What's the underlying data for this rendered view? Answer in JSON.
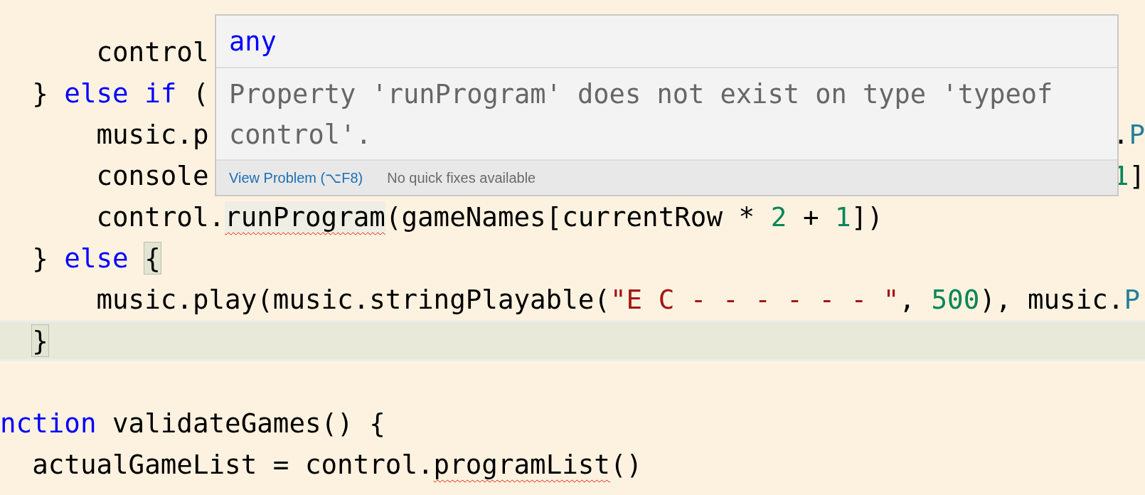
{
  "editor": {
    "lines": [
      {
        "current": false,
        "tokens": [
          {
            "kind": "plain",
            "text": "      control"
          }
        ]
      },
      {
        "current": false,
        "tokens": [
          {
            "kind": "plain",
            "text": "  } "
          },
          {
            "kind": "keyword",
            "text": "else if"
          },
          {
            "kind": "plain",
            "text": " ("
          }
        ]
      },
      {
        "current": false,
        "tokens": [
          {
            "kind": "plain",
            "text": "      music.p"
          }
        ],
        "right": [
          {
            "kind": "plain",
            "text": "."
          },
          {
            "kind": "type",
            "text": "P"
          }
        ]
      },
      {
        "current": false,
        "tokens": [
          {
            "kind": "plain",
            "text": "      console"
          }
        ],
        "right": [
          {
            "kind": "number",
            "text": "1"
          },
          {
            "kind": "plain",
            "text": "]"
          }
        ]
      },
      {
        "current": false,
        "tokens": [
          {
            "kind": "plain",
            "text": "      control."
          },
          {
            "kind": "hovered_error",
            "text": "runProgram"
          },
          {
            "kind": "plain",
            "text": "(gameNames[currentRow * "
          },
          {
            "kind": "number",
            "text": "2"
          },
          {
            "kind": "plain",
            "text": " + "
          },
          {
            "kind": "number",
            "text": "1"
          },
          {
            "kind": "plain",
            "text": "])"
          }
        ]
      },
      {
        "current": false,
        "tokens": [
          {
            "kind": "plain",
            "text": "  } "
          },
          {
            "kind": "keyword",
            "text": "else "
          },
          {
            "kind": "bracket",
            "text": "{"
          }
        ]
      },
      {
        "current": false,
        "tokens": [
          {
            "kind": "plain",
            "text": "      music.play(music.stringPlayable("
          },
          {
            "kind": "string",
            "text": "\"E C - - - - - - \""
          },
          {
            "kind": "plain",
            "text": ", "
          },
          {
            "kind": "number",
            "text": "500"
          },
          {
            "kind": "plain",
            "text": "), music."
          },
          {
            "kind": "type",
            "text": "P"
          }
        ]
      },
      {
        "current": true,
        "tokens": [
          {
            "kind": "bracket",
            "text": "  }"
          }
        ]
      },
      {
        "current": false
      },
      {
        "current": false,
        "tokens": [
          {
            "kind": "keyword",
            "text": "nction"
          },
          {
            "kind": "plain",
            "text": " validateGames() {"
          }
        ]
      },
      {
        "current": false,
        "tokens": [
          {
            "kind": "plain",
            "text": "  actualGameList = control."
          },
          {
            "kind": "error",
            "text": "programList"
          },
          {
            "kind": "plain",
            "text": "()"
          }
        ]
      }
    ]
  },
  "hover_popup": {
    "type_text": "any",
    "message": "Property 'runProgram' does not exist on type 'typeof control'.",
    "action_link": "View Problem (⌥F8)",
    "note": "No quick fixes available"
  }
}
